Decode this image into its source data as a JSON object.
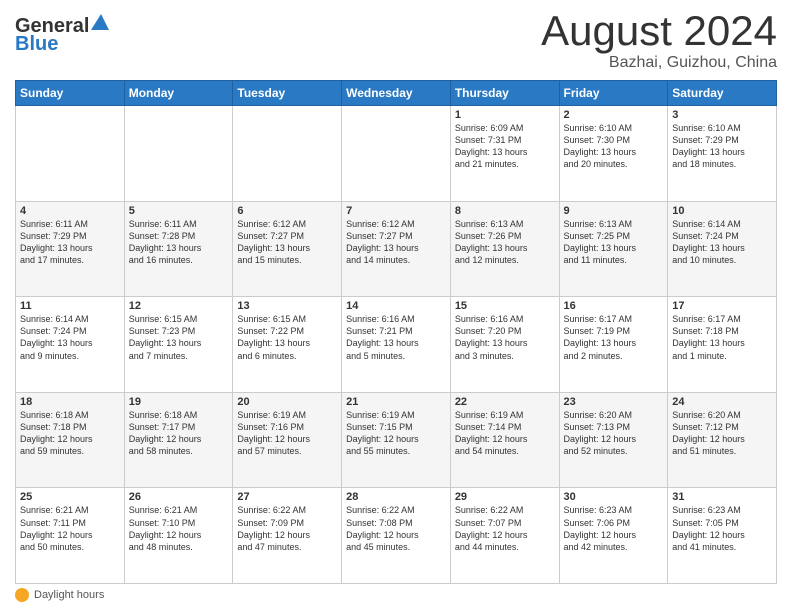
{
  "header": {
    "logo_line1": "General",
    "logo_line2": "Blue",
    "month_year": "August 2024",
    "location": "Bazhai, Guizhou, China"
  },
  "days_of_week": [
    "Sunday",
    "Monday",
    "Tuesday",
    "Wednesday",
    "Thursday",
    "Friday",
    "Saturday"
  ],
  "weeks": [
    [
      {
        "num": "",
        "info": ""
      },
      {
        "num": "",
        "info": ""
      },
      {
        "num": "",
        "info": ""
      },
      {
        "num": "",
        "info": ""
      },
      {
        "num": "1",
        "info": "Sunrise: 6:09 AM\nSunset: 7:31 PM\nDaylight: 13 hours\nand 21 minutes."
      },
      {
        "num": "2",
        "info": "Sunrise: 6:10 AM\nSunset: 7:30 PM\nDaylight: 13 hours\nand 20 minutes."
      },
      {
        "num": "3",
        "info": "Sunrise: 6:10 AM\nSunset: 7:29 PM\nDaylight: 13 hours\nand 18 minutes."
      }
    ],
    [
      {
        "num": "4",
        "info": "Sunrise: 6:11 AM\nSunset: 7:29 PM\nDaylight: 13 hours\nand 17 minutes."
      },
      {
        "num": "5",
        "info": "Sunrise: 6:11 AM\nSunset: 7:28 PM\nDaylight: 13 hours\nand 16 minutes."
      },
      {
        "num": "6",
        "info": "Sunrise: 6:12 AM\nSunset: 7:27 PM\nDaylight: 13 hours\nand 15 minutes."
      },
      {
        "num": "7",
        "info": "Sunrise: 6:12 AM\nSunset: 7:27 PM\nDaylight: 13 hours\nand 14 minutes."
      },
      {
        "num": "8",
        "info": "Sunrise: 6:13 AM\nSunset: 7:26 PM\nDaylight: 13 hours\nand 12 minutes."
      },
      {
        "num": "9",
        "info": "Sunrise: 6:13 AM\nSunset: 7:25 PM\nDaylight: 13 hours\nand 11 minutes."
      },
      {
        "num": "10",
        "info": "Sunrise: 6:14 AM\nSunset: 7:24 PM\nDaylight: 13 hours\nand 10 minutes."
      }
    ],
    [
      {
        "num": "11",
        "info": "Sunrise: 6:14 AM\nSunset: 7:24 PM\nDaylight: 13 hours\nand 9 minutes."
      },
      {
        "num": "12",
        "info": "Sunrise: 6:15 AM\nSunset: 7:23 PM\nDaylight: 13 hours\nand 7 minutes."
      },
      {
        "num": "13",
        "info": "Sunrise: 6:15 AM\nSunset: 7:22 PM\nDaylight: 13 hours\nand 6 minutes."
      },
      {
        "num": "14",
        "info": "Sunrise: 6:16 AM\nSunset: 7:21 PM\nDaylight: 13 hours\nand 5 minutes."
      },
      {
        "num": "15",
        "info": "Sunrise: 6:16 AM\nSunset: 7:20 PM\nDaylight: 13 hours\nand 3 minutes."
      },
      {
        "num": "16",
        "info": "Sunrise: 6:17 AM\nSunset: 7:19 PM\nDaylight: 13 hours\nand 2 minutes."
      },
      {
        "num": "17",
        "info": "Sunrise: 6:17 AM\nSunset: 7:18 PM\nDaylight: 13 hours\nand 1 minute."
      }
    ],
    [
      {
        "num": "18",
        "info": "Sunrise: 6:18 AM\nSunset: 7:18 PM\nDaylight: 12 hours\nand 59 minutes."
      },
      {
        "num": "19",
        "info": "Sunrise: 6:18 AM\nSunset: 7:17 PM\nDaylight: 12 hours\nand 58 minutes."
      },
      {
        "num": "20",
        "info": "Sunrise: 6:19 AM\nSunset: 7:16 PM\nDaylight: 12 hours\nand 57 minutes."
      },
      {
        "num": "21",
        "info": "Sunrise: 6:19 AM\nSunset: 7:15 PM\nDaylight: 12 hours\nand 55 minutes."
      },
      {
        "num": "22",
        "info": "Sunrise: 6:19 AM\nSunset: 7:14 PM\nDaylight: 12 hours\nand 54 minutes."
      },
      {
        "num": "23",
        "info": "Sunrise: 6:20 AM\nSunset: 7:13 PM\nDaylight: 12 hours\nand 52 minutes."
      },
      {
        "num": "24",
        "info": "Sunrise: 6:20 AM\nSunset: 7:12 PM\nDaylight: 12 hours\nand 51 minutes."
      }
    ],
    [
      {
        "num": "25",
        "info": "Sunrise: 6:21 AM\nSunset: 7:11 PM\nDaylight: 12 hours\nand 50 minutes."
      },
      {
        "num": "26",
        "info": "Sunrise: 6:21 AM\nSunset: 7:10 PM\nDaylight: 12 hours\nand 48 minutes."
      },
      {
        "num": "27",
        "info": "Sunrise: 6:22 AM\nSunset: 7:09 PM\nDaylight: 12 hours\nand 47 minutes."
      },
      {
        "num": "28",
        "info": "Sunrise: 6:22 AM\nSunset: 7:08 PM\nDaylight: 12 hours\nand 45 minutes."
      },
      {
        "num": "29",
        "info": "Sunrise: 6:22 AM\nSunset: 7:07 PM\nDaylight: 12 hours\nand 44 minutes."
      },
      {
        "num": "30",
        "info": "Sunrise: 6:23 AM\nSunset: 7:06 PM\nDaylight: 12 hours\nand 42 minutes."
      },
      {
        "num": "31",
        "info": "Sunrise: 6:23 AM\nSunset: 7:05 PM\nDaylight: 12 hours\nand 41 minutes."
      }
    ]
  ],
  "footer": {
    "daylight_label": "Daylight hours"
  }
}
